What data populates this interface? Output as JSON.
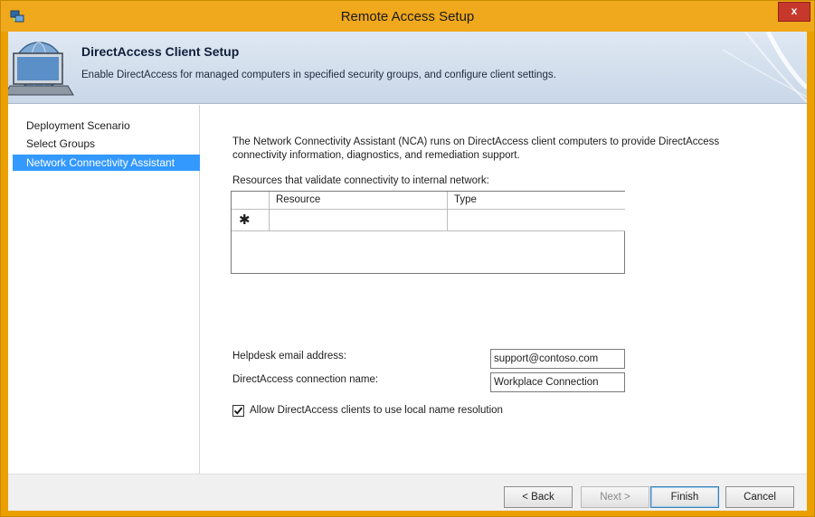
{
  "window": {
    "title": "Remote Access Setup",
    "close_label": "x",
    "accent_color": "#f0a81c"
  },
  "banner": {
    "title": "DirectAccess Client Setup",
    "subtitle": "Enable DirectAccess for managed computers in specified security groups, and configure client settings."
  },
  "nav": {
    "items": [
      {
        "label": "Deployment Scenario",
        "selected": false
      },
      {
        "label": "Select Groups",
        "selected": false
      },
      {
        "label": "Network Connectivity Assistant",
        "selected": true
      }
    ]
  },
  "content": {
    "intro": "The Network Connectivity Assistant (NCA) runs on DirectAccess client computers to provide DirectAccess connectivity information, diagnostics, and remediation support.",
    "resources_label": "Resources that validate connectivity to internal network:",
    "grid": {
      "columns": [
        "Resource",
        "Type"
      ],
      "new_row_marker": "✱"
    },
    "helpdesk_label": "Helpdesk email address:",
    "helpdesk_value": "support@contoso.com",
    "connection_label": "DirectAccess connection name:",
    "connection_value": "Workplace Connection",
    "local_name_resolution_label": "Allow DirectAccess clients to use local name resolution",
    "local_name_resolution_checked": true
  },
  "footer": {
    "back_label": "< Back",
    "next_label": "Next >",
    "finish_label": "Finish",
    "cancel_label": "Cancel"
  }
}
